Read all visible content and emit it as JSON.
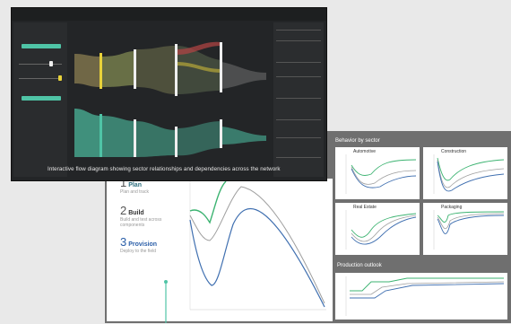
{
  "back_dashboard": {
    "steps": [
      {
        "num": "1",
        "title": "Plan",
        "desc": "Plan and track"
      },
      {
        "num": "2",
        "title": "Build",
        "desc": "Build and test across components"
      },
      {
        "num": "3",
        "title": "Provision",
        "desc": "Deploy to the field"
      }
    ],
    "section_title": "Behavior by sector",
    "mini_charts": [
      "Automotive",
      "Construction",
      "Real Estate",
      "Packaging"
    ],
    "bottom_title": "Production outlook"
  },
  "dark_dashboard": {
    "caption": "Interactive flow diagram showing sector relationships and dependencies across the network"
  },
  "colors": {
    "teal": "#4fc4a6",
    "green": "#3cb371",
    "blue": "#3f6fb0",
    "gray_line": "#9e9e9e",
    "yellow": "#e8d23a",
    "red": "#d04a4a"
  }
}
